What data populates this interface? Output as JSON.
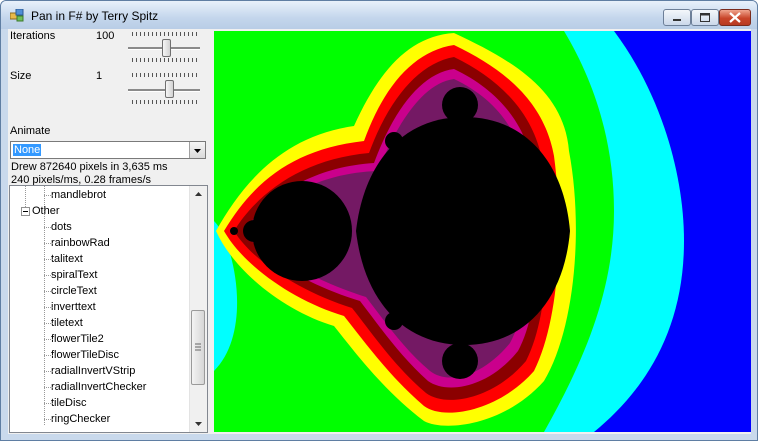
{
  "window": {
    "title": "Pan in F# by Terry Spitz",
    "controls": {
      "minimize": "minimize",
      "maximize": "maximize",
      "close": "close"
    }
  },
  "iterations": {
    "label": "Iterations",
    "value": "100",
    "slider_level": 0.42
  },
  "size": {
    "label": "Size",
    "value": "1",
    "slider_level": 0.55
  },
  "animate": {
    "label": "Animate",
    "selected": "None"
  },
  "status": {
    "line1": "Drew 872640 pixels in 3,635 ms",
    "line2": "240 pixels/ms, 0.28 frames/s"
  },
  "tree": {
    "items": [
      {
        "label": "mandlebrot",
        "level": 2
      },
      {
        "label": "Other",
        "level": 1,
        "expanded": true
      },
      {
        "label": "dots",
        "level": 2
      },
      {
        "label": "rainbowRad",
        "level": 2
      },
      {
        "label": "talitext",
        "level": 2
      },
      {
        "label": "spiralText",
        "level": 2
      },
      {
        "label": "circleText",
        "level": 2
      },
      {
        "label": "inverttext",
        "level": 2
      },
      {
        "label": "tiletext",
        "level": 2
      },
      {
        "label": "flowerTile2",
        "level": 2
      },
      {
        "label": "flowerTileDisc",
        "level": 2
      },
      {
        "label": "radialInvertVStrip",
        "level": 2
      },
      {
        "label": "radialInvertChecker",
        "level": 2
      },
      {
        "label": "tileDisc",
        "level": 2
      },
      {
        "label": "ringChecker",
        "level": 2
      }
    ]
  },
  "render": {
    "description_colors": [
      "#0000ff",
      "#00ffff",
      "#00ff00",
      "#ffff00",
      "#ff0000",
      "#8b0000",
      "#000000"
    ]
  }
}
